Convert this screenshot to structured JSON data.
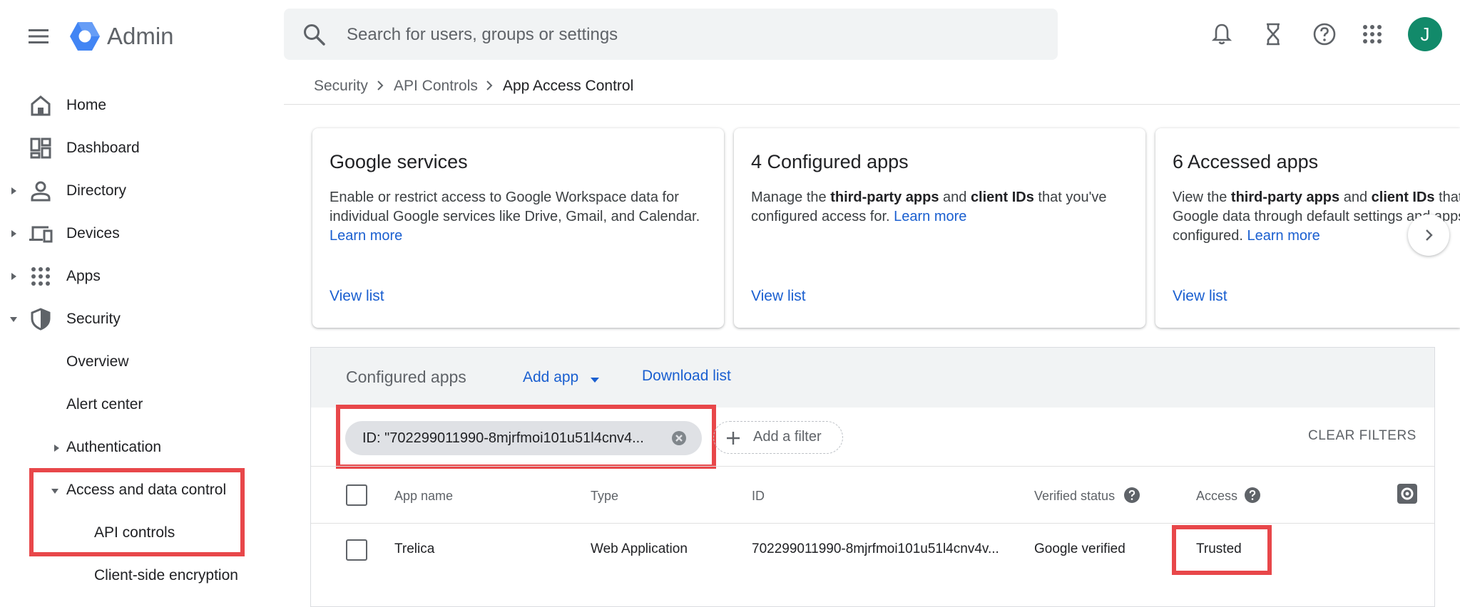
{
  "header": {
    "brand": "Admin",
    "search_placeholder": "Search for users, groups or settings",
    "avatar_initial": "J"
  },
  "sidebar": {
    "items": [
      {
        "label": "Home",
        "icon": "home-icon"
      },
      {
        "label": "Dashboard",
        "icon": "dashboard-icon"
      },
      {
        "label": "Directory",
        "icon": "person-icon"
      },
      {
        "label": "Devices",
        "icon": "devices-icon"
      },
      {
        "label": "Apps",
        "icon": "apps-grid-icon"
      },
      {
        "label": "Security",
        "icon": "shield-icon"
      }
    ],
    "security_sub": {
      "overview": "Overview",
      "alert_center": "Alert center",
      "authentication": "Authentication",
      "access_data_control": "Access and data control",
      "api_controls": "API controls",
      "client_side_encryption": "Client-side encryption"
    }
  },
  "breadcrumb": [
    "Security",
    "API Controls",
    "App Access Control"
  ],
  "cards": [
    {
      "title": "Google services",
      "desc": "Enable or restrict access to Google Workspace data for individual Google services like Drive, Gmail, and Calendar.",
      "learn_more": "Learn more",
      "view": "View list"
    },
    {
      "title": "4 Configured apps",
      "desc_pre": "Manage the ",
      "desc_b1": "third-party apps",
      "desc_mid": " and ",
      "desc_b2": "client IDs",
      "desc_post": " that you've configured access for.",
      "learn_more": "Learn more",
      "view": "View list"
    },
    {
      "title": "6 Accessed apps",
      "desc_pre": "View the ",
      "desc_b1": "third-party apps",
      "desc_mid": " and ",
      "desc_b2": "client IDs",
      "desc_post": " that accessed Google data through default settings and apps that you have configured.",
      "learn_more": "Learn more",
      "view": "View list"
    }
  ],
  "panel": {
    "title": "Configured apps",
    "add_app": "Add app",
    "download": "Download list",
    "filter_chip": "ID: \"702299011990-8mjrfmoi101u51l4cnv4...",
    "add_filter": "Add a filter",
    "clear_filters": "CLEAR FILTERS",
    "columns": [
      "App name",
      "Type",
      "ID",
      "Verified status",
      "Access"
    ],
    "rows": [
      {
        "app_name": "Trelica",
        "type": "Web Application",
        "id": "702299011990-8mjrfmoi101u51l4cnv4v...",
        "verified": "Google verified",
        "access": "Trusted"
      }
    ]
  },
  "colors": {
    "accent": "#1a5fd0",
    "highlight": "#e8474a",
    "avatar": "#128a6a"
  }
}
